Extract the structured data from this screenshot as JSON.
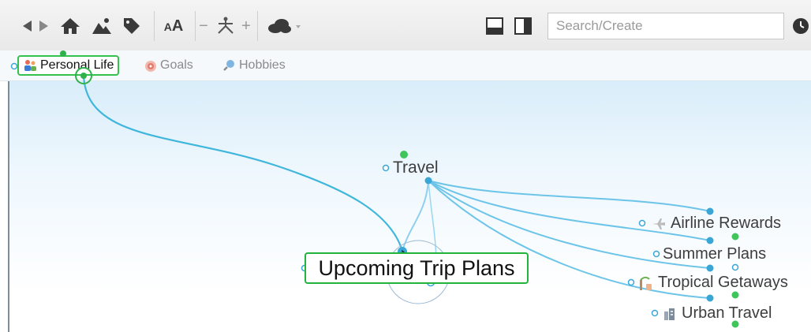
{
  "toolbar": {
    "buttons": [
      {
        "name": "back-forward",
        "icon": "back-forward-arrows"
      },
      {
        "name": "home",
        "icon": "home-icon"
      },
      {
        "name": "map",
        "icon": "landscape-icon"
      },
      {
        "name": "tags",
        "icon": "tag-icon"
      },
      {
        "name": "text-size",
        "icon": "font-size-icon",
        "label": "AA"
      },
      {
        "name": "zoom-out",
        "label": "−"
      },
      {
        "name": "layout",
        "icon": "network-icon"
      },
      {
        "name": "zoom-in",
        "label": "+"
      },
      {
        "name": "cloud",
        "icon": "cloud-icon"
      }
    ],
    "search_placeholder": "Search/Create"
  },
  "breadcrumbs": [
    {
      "label": "Personal Life",
      "icon": "people-icon",
      "active": true
    },
    {
      "label": "Goals",
      "icon": "target-icon",
      "active": false
    },
    {
      "label": "Hobbies",
      "icon": "magnifier-icon",
      "active": false
    }
  ],
  "mindmap": {
    "central": "Upcoming Trip Plans",
    "nodes": {
      "travel": "Travel",
      "airline_rewards": "Airline Rewards",
      "summer_plans": "Summer Plans",
      "tropical_getaways": "Tropical Getaways",
      "urban_travel": "Urban Travel"
    }
  },
  "colors": {
    "accent_green": "#22b43c",
    "link_blue": "#35b5de",
    "link_blue_light": "#9bd4ee"
  }
}
